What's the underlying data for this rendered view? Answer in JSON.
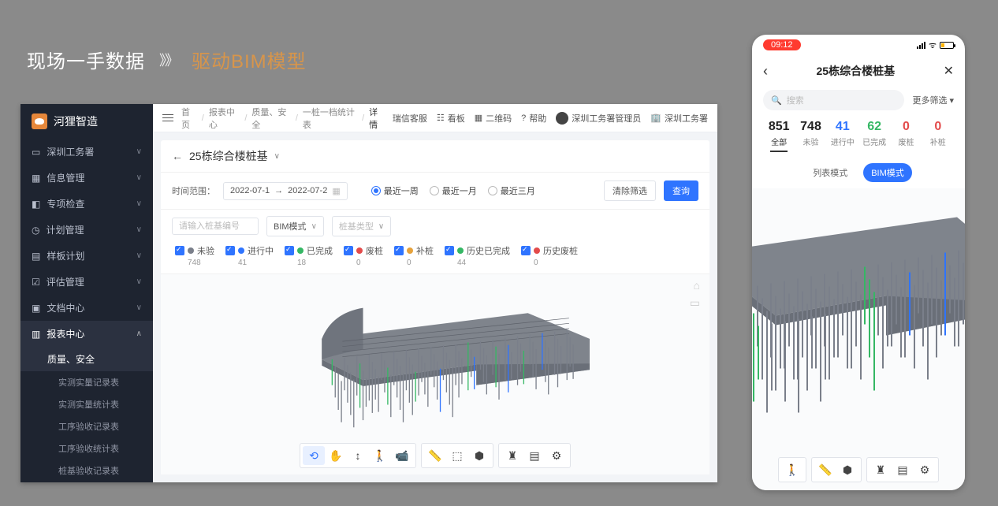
{
  "slide": {
    "title1": "现场一手数据",
    "arrows": "》》",
    "title2": "驱动BIM模型"
  },
  "desktop": {
    "logo": "河狸智造",
    "nav": [
      "深圳工务署",
      "信息管理",
      "专项检查",
      "计划管理",
      "样板计划",
      "评估管理",
      "文档中心",
      "报表中心"
    ],
    "subActive": "质量、安全",
    "sub2": [
      "实测实量记录表",
      "实测实量统计表",
      "工序验收记录表",
      "工序验收统计表",
      "桩基验收记录表"
    ],
    "breadcrumb": [
      "首页",
      "报表中心",
      "质量、安全",
      "一桩一档统计表",
      "详情"
    ],
    "topRight": {
      "cs": "瑞信客服",
      "board": "看板",
      "qr": "二维码",
      "help": "帮助",
      "user": "深圳工务署管理员",
      "org": "深圳工务署"
    },
    "pageTitle": "25栋综合楼桩基",
    "filters": {
      "rangeLabel": "时间范围：",
      "from": "2022-07-1",
      "to": "2022-07-2",
      "radios": [
        "最近一周",
        "最近一月",
        "最近三月"
      ],
      "radioSel": 0,
      "clear": "清除筛选",
      "query": "查询"
    },
    "row2": {
      "searchPh": "请输入桩基编号",
      "mode": "BIM模式",
      "typePh": "桩基类型"
    },
    "legend": [
      {
        "label": "未验",
        "count": 748,
        "color": "#7a7f8a"
      },
      {
        "label": "进行中",
        "count": 41,
        "color": "#2f74ff"
      },
      {
        "label": "已完成",
        "count": 18,
        "color": "#35b764"
      },
      {
        "label": "废桩",
        "count": 0,
        "color": "#e34b4b"
      },
      {
        "label": "补桩",
        "count": 0,
        "color": "#e6a23c"
      },
      {
        "label": "历史已完成",
        "count": 44,
        "color": "#35b764"
      },
      {
        "label": "历史废桩",
        "count": 0,
        "color": "#e34b4b"
      }
    ],
    "toolbar": [
      "orbit",
      "pan",
      "walk",
      "person",
      "video",
      "ruler",
      "box",
      "cube",
      "tree",
      "layers",
      "gear"
    ]
  },
  "mobile": {
    "time": "09:12",
    "title": "25栋综合楼桩基",
    "searchPh": "搜索",
    "more": "更多筛选",
    "stats": [
      {
        "num": 851,
        "lab": "全部",
        "color": "#222",
        "sel": true
      },
      {
        "num": 748,
        "lab": "未验",
        "color": "#222"
      },
      {
        "num": 41,
        "lab": "进行中",
        "color": "#2f74ff"
      },
      {
        "num": 62,
        "lab": "已完成",
        "color": "#35b764"
      },
      {
        "num": 0,
        "lab": "废桩",
        "color": "#e34b4b"
      },
      {
        "num": 0,
        "lab": "补桩",
        "color": "#e34b4b"
      }
    ],
    "toggle": {
      "list": "列表模式",
      "bim": "BIM模式"
    }
  }
}
